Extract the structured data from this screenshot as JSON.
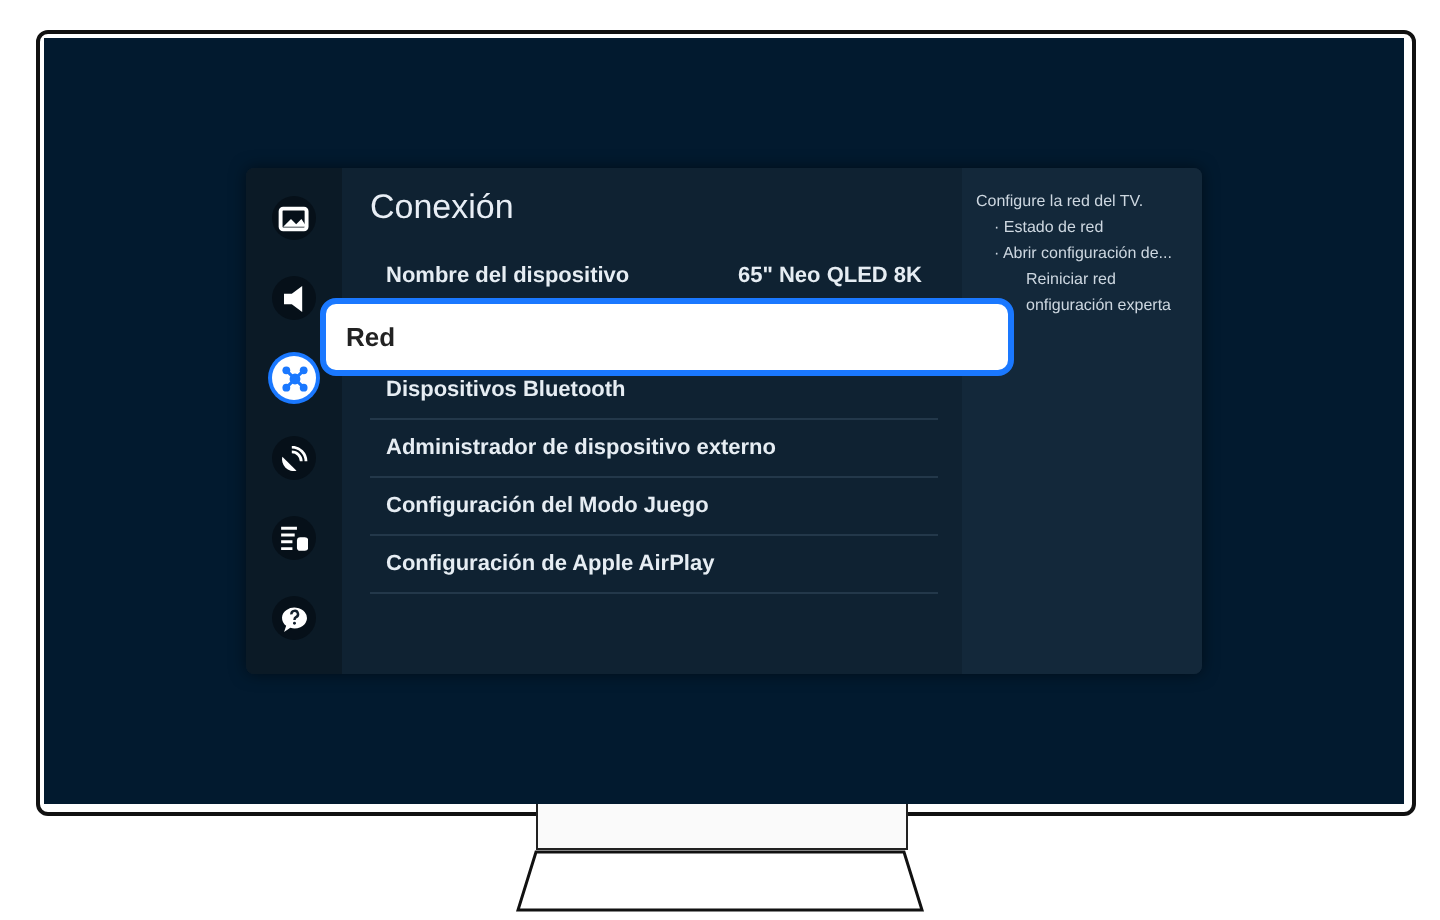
{
  "sidebar": {
    "items": [
      {
        "kind": "picture",
        "selected": false
      },
      {
        "kind": "sound",
        "selected": false
      },
      {
        "kind": "network",
        "selected": true
      },
      {
        "kind": "satellite",
        "selected": false
      },
      {
        "kind": "list",
        "selected": false
      },
      {
        "kind": "help",
        "selected": false
      }
    ]
  },
  "menu": {
    "title": "Conexión",
    "rows": [
      {
        "label": "Nombre del dispositivo",
        "value": "65\" Neo QLED 8K",
        "focused": false
      },
      {
        "label": "Red",
        "focused": true
      },
      {
        "label": "Dispositivos Bluetooth",
        "focused": false
      },
      {
        "label": "Administrador de dispositivo externo",
        "focused": false
      },
      {
        "label": "Configuración del Modo Juego",
        "focused": false
      },
      {
        "label": "Configuración de Apple AirPlay",
        "focused": false
      }
    ]
  },
  "help": {
    "description": "Configure la red del TV.",
    "lines": [
      {
        "text": "· Estado de red",
        "kind": "bullet"
      },
      {
        "text": "· Abrir configuración de...",
        "kind": "bullet"
      },
      {
        "text": "Reiniciar red",
        "kind": "cut"
      },
      {
        "text": "onfiguración experta",
        "kind": "cut"
      }
    ]
  }
}
